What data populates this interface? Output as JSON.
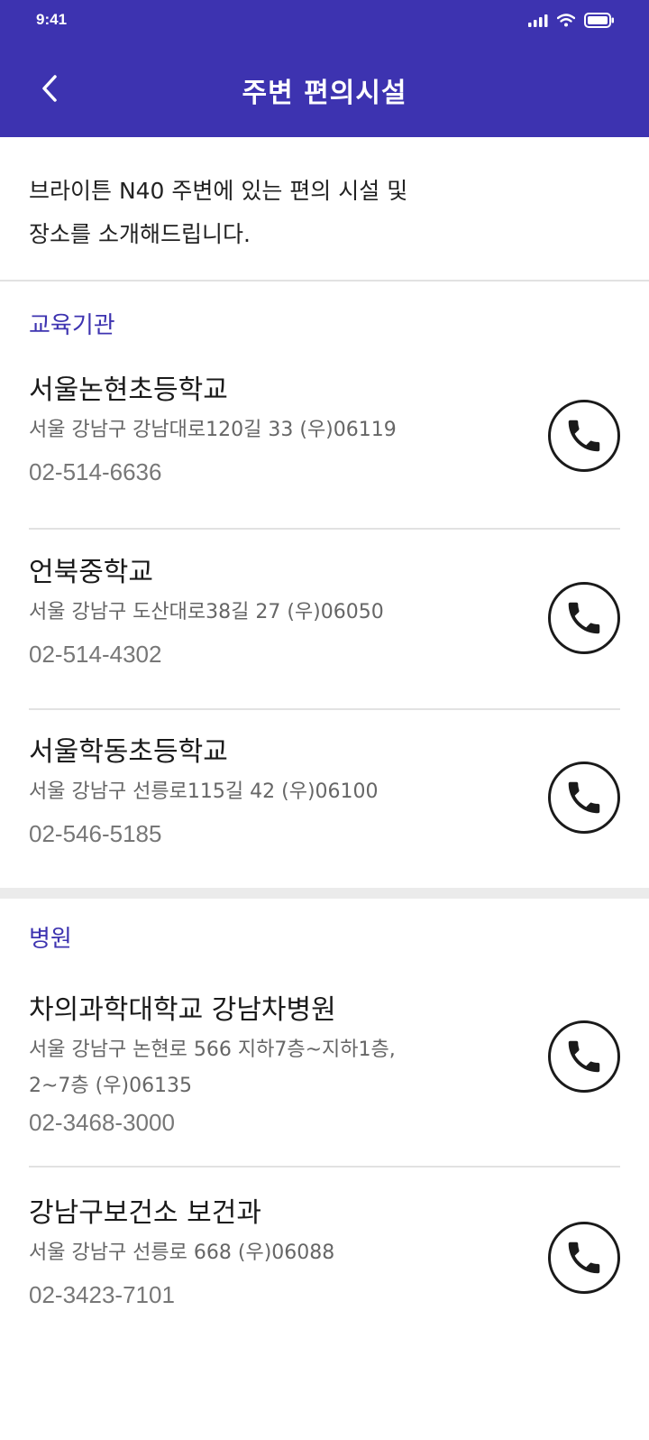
{
  "status_bar": {
    "time": "9:41"
  },
  "header": {
    "title": "주변 편의시설"
  },
  "intro": {
    "line1": "브라이튼 N40 주변에 있는 편의 시설 및",
    "line2": "장소를 소개해드립니다."
  },
  "sections": [
    {
      "title": "교육기관",
      "items": [
        {
          "name": "서울논현초등학교",
          "address": "서울 강남구 강남대로120길 33 (우)06119",
          "phone": "02-514-6636"
        },
        {
          "name": "언북중학교",
          "address": "서울 강남구 도산대로38길 27 (우)06050",
          "phone": "02-514-4302"
        },
        {
          "name": "서울학동초등학교",
          "address": "서울 강남구 선릉로115길 42 (우)06100",
          "phone": "02-546-5185"
        }
      ]
    },
    {
      "title": "병원",
      "items": [
        {
          "name": "차의과학대학교 강남차병원",
          "address_line1": "서울 강남구 논현로 566 지하7층~지하1층,",
          "address_line2": "2~7층 (우)06135",
          "phone": "02-3468-3000"
        },
        {
          "name": "강남구보건소 보건과",
          "address": "서울 강남구 선릉로 668 (우)06088",
          "phone": "02-3423-7101"
        }
      ]
    }
  ],
  "colors": {
    "accent": "#3d33b0",
    "text": "#1a1a1a",
    "muted": "#666666",
    "divider": "#e2e2e2"
  },
  "icons": {
    "back": "chevron-left-icon",
    "call": "phone-icon",
    "signal": "signal-icon",
    "wifi": "wifi-icon",
    "battery": "battery-icon"
  }
}
